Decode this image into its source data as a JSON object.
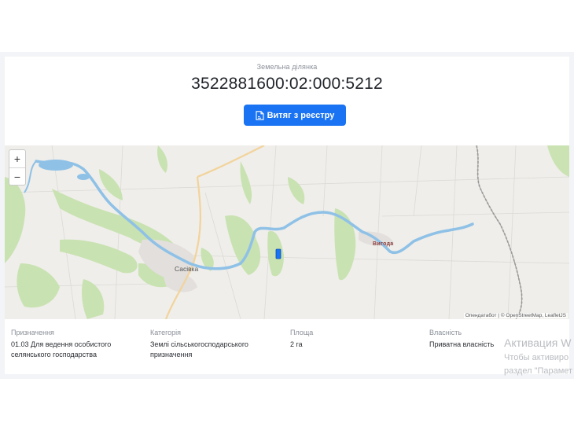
{
  "header": {
    "subtitle": "Земельна ділянка",
    "parcel_id": "3522881600:02:000:5212",
    "extract_button_label": "Витяг з реєстру"
  },
  "map": {
    "zoom_in": "+",
    "zoom_out": "−",
    "place_labels": {
      "town": "Сасівка",
      "village": "Вигода"
    },
    "attribution": "Опендатабот | © OpenStreetMap, LeafletJS",
    "colors": {
      "river": "#8fc1e7",
      "forest": "#c8e2b0",
      "road": "#f2d39b",
      "parcel": "#1a73f3"
    }
  },
  "details": [
    {
      "label": "Призначення",
      "value": "01.03 Для ведення особистого селянського господарства"
    },
    {
      "label": "Категорія",
      "value": "Землі сільськогосподарського призначення"
    },
    {
      "label": "Площа",
      "value": "2 га"
    },
    {
      "label": "Власність",
      "value": "Приватна власність"
    }
  ],
  "watermark": {
    "line1": "Активация W",
    "line2": "Чтобы активиро",
    "line3": "раздел \"Парамет"
  }
}
